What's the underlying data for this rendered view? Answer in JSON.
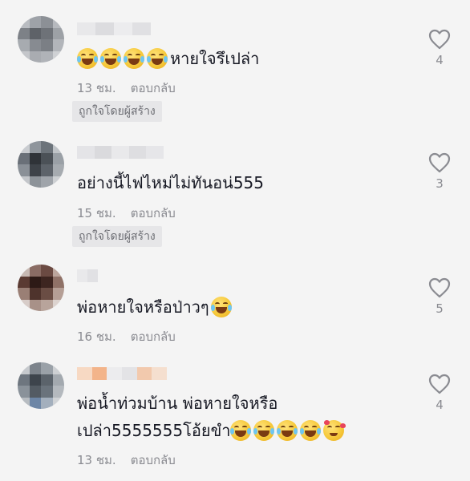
{
  "comments": [
    {
      "text": "หายใจรึเปล่า",
      "leading_emojis": [
        "face-with-tears-of-joy",
        "face-with-tears-of-joy",
        "face-with-tears-of-joy",
        "face-with-tears-of-joy"
      ],
      "time": "13 ชม.",
      "reply_label": "ตอบกลับ",
      "creator_badge": "ถูกใจโดยผู้สร้าง",
      "likes": "4"
    },
    {
      "text": "อย่างนี้ไฟไหม่ไม่ทันอน่555",
      "time": "15 ชม.",
      "reply_label": "ตอบกลับ",
      "creator_badge": "ถูกใจโดยผู้สร้าง",
      "likes": "3"
    },
    {
      "text": "พ่อหายใจหรือป่าวๆ",
      "trailing_emoji": "face-with-tears-of-joy",
      "time": "16 ชม.",
      "reply_label": "ตอบกลับ",
      "likes": "5"
    },
    {
      "text_line1": "พ่อน้ำท่วมบ้าน พ่อหายใจหรือ",
      "text_line2": "เปล่า5555555โอ้ยขำ",
      "trailing_emojis": [
        "face-with-tears-of-joy",
        "face-with-tears-of-joy",
        "face-with-tears-of-joy",
        "face-with-tears-of-joy",
        "smiling-face-with-hearts"
      ],
      "time": "13 ชม.",
      "reply_label": "ตอบกลับ",
      "likes": "4"
    }
  ],
  "icons": {
    "like": "heart-outline-icon"
  },
  "colors": {
    "background": "#f4f4f4",
    "text": "#161823",
    "muted": "#8a8b91",
    "badge_bg": "#e6e6e8"
  }
}
